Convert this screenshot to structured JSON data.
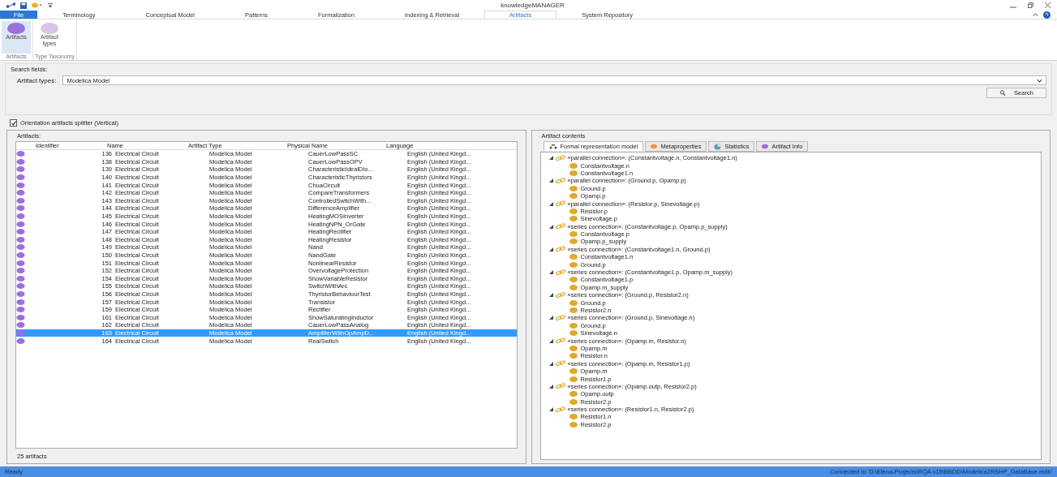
{
  "window": {
    "title": "knowledgeMANAGER"
  },
  "menu_tabs": [
    {
      "label": "File",
      "selected": false,
      "kind": "file"
    },
    {
      "label": "Terminology",
      "selected": false,
      "kind": "tab"
    },
    {
      "label": "Conceptual Model",
      "selected": false,
      "kind": "tab"
    },
    {
      "label": "Patterns",
      "selected": false,
      "kind": "tab"
    },
    {
      "label": "Formalization",
      "selected": false,
      "kind": "tab"
    },
    {
      "label": "Indexing & Retrieval",
      "selected": false,
      "kind": "tab"
    },
    {
      "label": "Artifacts",
      "selected": true,
      "kind": "tab"
    },
    {
      "label": "System Repository",
      "selected": false,
      "kind": "tab"
    }
  ],
  "ribbon": {
    "groups": [
      {
        "label": "Artifacts",
        "buttons": [
          {
            "label": "Artifacts",
            "selected": true,
            "color": "#9b6fe0"
          }
        ]
      },
      {
        "label": "Type Taxonomy",
        "buttons": [
          {
            "label": "Artifact types",
            "selected": false,
            "color": "#d8c4e8"
          }
        ]
      }
    ]
  },
  "search": {
    "title": "Search fields:",
    "artifact_types_label": "Artifact types:",
    "artifact_types_value": "Modelica Model",
    "button": "Search"
  },
  "splitter_option": {
    "label": "Orientation artifacts splitter (Vertical)",
    "checked": true
  },
  "artifacts": {
    "title": "Artifacts:",
    "columns": [
      "Identifier",
      "Name",
      "Artifact Type",
      "Physical Name",
      "Language"
    ],
    "rows": [
      {
        "id": "136",
        "name": "Electrical Circuit",
        "type": "Modelica Model",
        "physical": "CauerLowPassSC",
        "language": "English (United Kingd...",
        "selected": false
      },
      {
        "id": "138",
        "name": "Electrical Circuit",
        "type": "Modelica Model",
        "physical": "CauerLowPassOPV",
        "language": "English (United Kingd...",
        "selected": false
      },
      {
        "id": "139",
        "name": "Electrical Circuit",
        "type": "Modelica Model",
        "physical": "CharacteristicIdealDio...",
        "language": "English (United Kingd...",
        "selected": false
      },
      {
        "id": "140",
        "name": "Electrical Circuit",
        "type": "Modelica Model",
        "physical": "CharacteristicThyristors",
        "language": "English (United Kingd...",
        "selected": false
      },
      {
        "id": "141",
        "name": "Electrical Circuit",
        "type": "Modelica Model",
        "physical": "ChuaCircuit",
        "language": "English (United Kingd...",
        "selected": false
      },
      {
        "id": "142",
        "name": "Electrical Circuit",
        "type": "Modelica Model",
        "physical": "CompareTransformers",
        "language": "English (United Kingd...",
        "selected": false
      },
      {
        "id": "143",
        "name": "Electrical Circuit",
        "type": "Modelica Model",
        "physical": "ControlledSwitchWith...",
        "language": "English (United Kingd...",
        "selected": false
      },
      {
        "id": "144",
        "name": "Electrical Circuit",
        "type": "Modelica Model",
        "physical": "DifferenceAmplifier",
        "language": "English (United Kingd...",
        "selected": false
      },
      {
        "id": "145",
        "name": "Electrical Circuit",
        "type": "Modelica Model",
        "physical": "HeatingMOSInverter",
        "language": "English (United Kingd...",
        "selected": false
      },
      {
        "id": "146",
        "name": "Electrical Circuit",
        "type": "Modelica Model",
        "physical": "HeatingNPN_OrGate",
        "language": "English (United Kingd...",
        "selected": false
      },
      {
        "id": "147",
        "name": "Electrical Circuit",
        "type": "Modelica Model",
        "physical": "HeatingRectifier",
        "language": "English (United Kingd...",
        "selected": false
      },
      {
        "id": "148",
        "name": "Electrical Circuit",
        "type": "Modelica Model",
        "physical": "HeatingResistor",
        "language": "English (United Kingd...",
        "selected": false
      },
      {
        "id": "149",
        "name": "Electrical Circuit",
        "type": "Modelica Model",
        "physical": "Nand",
        "language": "English (United Kingd...",
        "selected": false
      },
      {
        "id": "150",
        "name": "Electrical Circuit",
        "type": "Modelica Model",
        "physical": "NandGate",
        "language": "English (United Kingd...",
        "selected": false
      },
      {
        "id": "151",
        "name": "Electrical Circuit",
        "type": "Modelica Model",
        "physical": "NonlinearResistor",
        "language": "English (United Kingd...",
        "selected": false
      },
      {
        "id": "152",
        "name": "Electrical Circuit",
        "type": "Modelica Model",
        "physical": "OvervoltageProtection",
        "language": "English (United Kingd...",
        "selected": false
      },
      {
        "id": "154",
        "name": "Electrical Circuit",
        "type": "Modelica Model",
        "physical": "ShowVariableResistor",
        "language": "English (United Kingd...",
        "selected": false
      },
      {
        "id": "155",
        "name": "Electrical Circuit",
        "type": "Modelica Model",
        "physical": "SwitchWithArc",
        "language": "English (United Kingd...",
        "selected": false
      },
      {
        "id": "156",
        "name": "Electrical Circuit",
        "type": "Modelica Model",
        "physical": "ThyristorBehaviourTest",
        "language": "English (United Kingd...",
        "selected": false
      },
      {
        "id": "157",
        "name": "Electrical Circuit",
        "type": "Modelica Model",
        "physical": "Transistor",
        "language": "English (United Kingd...",
        "selected": false
      },
      {
        "id": "159",
        "name": "Electrical Circuit",
        "type": "Modelica Model",
        "physical": "Rectifier",
        "language": "English (United Kingd...",
        "selected": false
      },
      {
        "id": "161",
        "name": "Electrical Circuit",
        "type": "Modelica Model",
        "physical": "ShowSaturatingInductor",
        "language": "English (United Kingd...",
        "selected": false
      },
      {
        "id": "162",
        "name": "Electrical Circuit",
        "type": "Modelica Model",
        "physical": "CauerLowPassAnalog",
        "language": "English (United Kingd...",
        "selected": false
      },
      {
        "id": "163",
        "name": "Electrical Circuit",
        "type": "Modelica Model",
        "physical": "AmplifierWithOpAmpD...",
        "language": "English (United Kingd...",
        "selected": true
      },
      {
        "id": "164",
        "name": "Electrical Circuit",
        "type": "Modelica Model",
        "physical": "RealSwitch",
        "language": "English (United Kingd...",
        "selected": false
      }
    ],
    "footer": "25 artifacts"
  },
  "contents": {
    "title": "Artifact contents",
    "tabs": [
      {
        "label": "Formal representation model",
        "selected": true,
        "kind": "model"
      },
      {
        "label": "Metaproperties",
        "selected": false,
        "kind": "meta"
      },
      {
        "label": "Statistics",
        "selected": false,
        "kind": "stats"
      },
      {
        "label": "Artifact Info",
        "selected": false,
        "kind": "info"
      }
    ],
    "tree": [
      {
        "label": "«parallel connection»: (Constantvoltage.n, Constantvoltage1.n)",
        "expanded": true,
        "children": [
          {
            "label": "Constantvoltage.n"
          },
          {
            "label": "Constantvoltage1.n"
          }
        ]
      },
      {
        "label": "«parallel connection»: (Ground.p, Opamp.p)",
        "expanded": true,
        "children": [
          {
            "label": "Ground.p"
          },
          {
            "label": "Opamp.p"
          }
        ]
      },
      {
        "label": "«parallel connection»: (Resistor.p, Sinevoltage.p)",
        "expanded": true,
        "children": [
          {
            "label": "Resistor.p"
          },
          {
            "label": "Sinevoltage.p"
          }
        ]
      },
      {
        "label": "«series connection»: (Constantvoltage.p, Opamp.p_supply)",
        "expanded": true,
        "children": [
          {
            "label": "Constantvoltage.p"
          },
          {
            "label": "Opamp.p_supply"
          }
        ]
      },
      {
        "label": "«series connection»: (Constantvoltage1.n, Ground.p)",
        "expanded": true,
        "children": [
          {
            "label": "Constantvoltage1.n"
          },
          {
            "label": "Ground.p"
          }
        ]
      },
      {
        "label": "«series connection»: (Constantvoltage1.p, Opamp.m_supply)",
        "expanded": true,
        "children": [
          {
            "label": "Constantvoltage1.p"
          },
          {
            "label": "Opamp.m_supply"
          }
        ]
      },
      {
        "label": "«series connection»: (Ground.p, Resistor2.n)",
        "expanded": true,
        "children": [
          {
            "label": "Ground.p"
          },
          {
            "label": "Resistor2.n"
          }
        ]
      },
      {
        "label": "«series connection»: (Ground.p, Sinevoltage.n)",
        "expanded": true,
        "children": [
          {
            "label": "Ground.p"
          },
          {
            "label": "Sinevoltage.n"
          }
        ]
      },
      {
        "label": "«series connection»: (Opamp.m, Resistor.n)",
        "expanded": true,
        "children": [
          {
            "label": "Opamp.m"
          },
          {
            "label": "Resistor.n"
          }
        ]
      },
      {
        "label": "«series connection»: (Opamp.m, Resistor1.p)",
        "expanded": true,
        "children": [
          {
            "label": "Opamp.m"
          },
          {
            "label": "Resistor1.p"
          }
        ]
      },
      {
        "label": "«series connection»: (Opamp.outp, Resistor2.p)",
        "expanded": true,
        "children": [
          {
            "label": "Opamp.outp"
          },
          {
            "label": "Resistor2.p"
          }
        ]
      },
      {
        "label": "«series connection»: (Resistor1.n, Resistor2.p)",
        "expanded": true,
        "children": [
          {
            "label": "Resistor1.n"
          },
          {
            "label": "Resistor2.p"
          }
        ]
      }
    ]
  },
  "status_bar": {
    "left": "Ready",
    "right": "Connected to 'D:\\Elena-Projects\\RQA v15\\BBDD\\Modelica2RSHP_DataBase.mdb'"
  }
}
